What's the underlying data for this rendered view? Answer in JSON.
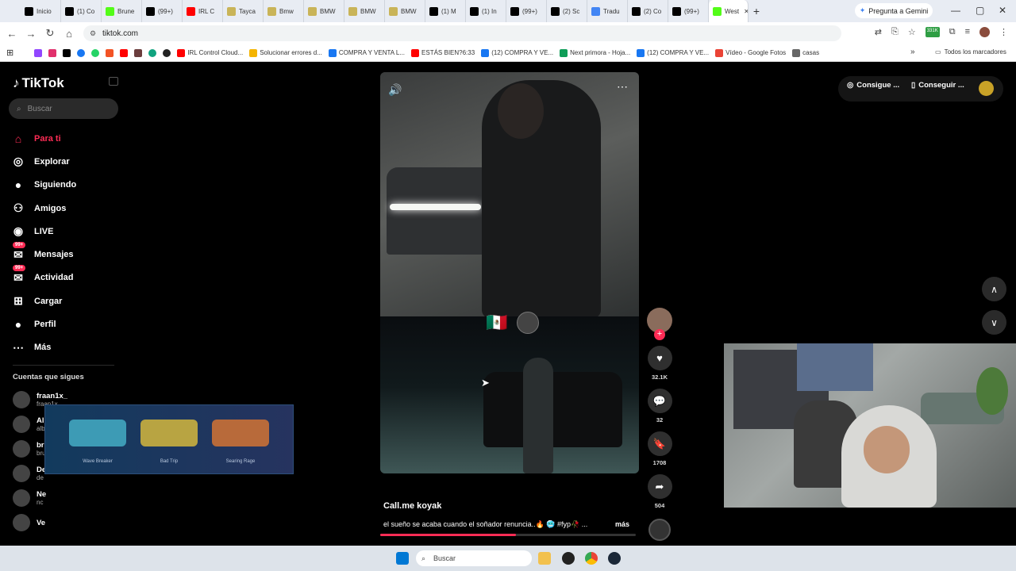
{
  "browser": {
    "tabs": [
      {
        "label": "Inicio",
        "icon": "x-icon",
        "color": "#000000"
      },
      {
        "label": "(1) Co",
        "icon": "x-icon",
        "color": "#000000"
      },
      {
        "label": "Brune",
        "icon": "kick-icon",
        "color": "#53fc18"
      },
      {
        "label": "(99+)",
        "icon": "tiktok-icon",
        "color": "#000000"
      },
      {
        "label": "IRL C",
        "icon": "youtube-icon",
        "color": "#ff0000"
      },
      {
        "label": "Tayca",
        "icon": "car-icon",
        "color": "#c9b458"
      },
      {
        "label": "Bmw",
        "icon": "car-icon",
        "color": "#c9b458"
      },
      {
        "label": "BMW",
        "icon": "car-icon",
        "color": "#c9b458"
      },
      {
        "label": "BMW",
        "icon": "car-icon",
        "color": "#c9b458"
      },
      {
        "label": "BMW",
        "icon": "car-icon",
        "color": "#c9b458"
      },
      {
        "label": "(1) M",
        "icon": "x-icon",
        "color": "#000000"
      },
      {
        "label": "(1) In",
        "icon": "x-icon",
        "color": "#000000"
      },
      {
        "label": "(99+)",
        "icon": "tiktok-icon",
        "color": "#000000"
      },
      {
        "label": "(2) Sc",
        "icon": "x-icon",
        "color": "#000000"
      },
      {
        "label": "Tradu",
        "icon": "translate-icon",
        "color": "#4285f4"
      },
      {
        "label": "(2) Co",
        "icon": "x-icon",
        "color": "#000000"
      },
      {
        "label": "(99+)",
        "icon": "tiktok-icon",
        "color": "#000000"
      },
      {
        "label": "West",
        "icon": "kick-icon",
        "color": "#53fc18"
      }
    ],
    "active_tab_close": "✕",
    "new_tab": "+",
    "gemini_label": "Pregunta a Gemini",
    "url": "tiktok.com",
    "extension_badge": "331K",
    "bookmarks": [
      {
        "label": "IRL Control Cloud...",
        "color": "#ff0000"
      },
      {
        "label": "Solucionar errores d...",
        "color": "#f4b400"
      },
      {
        "label": "COMPRA Y VENTA L...",
        "color": "#1877f2"
      },
      {
        "label": "ESTÁS BIEN?6:33",
        "color": "#ff0000"
      },
      {
        "label": "(12) COMPRA Y VE...",
        "color": "#1877f2"
      },
      {
        "label": "Next primora - Hoja...",
        "color": "#0f9d58"
      },
      {
        "label": "(12) COMPRA Y VE...",
        "color": "#1877f2"
      },
      {
        "label": "Vídeo - Google Fotos",
        "color": "#ea4335"
      },
      {
        "label": "casas",
        "color": "#666666"
      }
    ],
    "all_bookmarks": "Todos los marcadores"
  },
  "tiktok": {
    "logo": "TikTok",
    "search_placeholder": "Buscar",
    "nav": [
      {
        "label": "Para ti",
        "icon": "home-icon",
        "active": true
      },
      {
        "label": "Explorar",
        "icon": "compass-icon"
      },
      {
        "label": "Siguiendo",
        "icon": "following-icon"
      },
      {
        "label": "Amigos",
        "icon": "friends-icon"
      },
      {
        "label": "LIVE",
        "icon": "live-icon"
      },
      {
        "label": "Mensajes",
        "icon": "message-icon",
        "badge": "99+"
      },
      {
        "label": "Actividad",
        "icon": "activity-icon",
        "badge": "99+"
      },
      {
        "label": "Cargar",
        "icon": "upload-icon"
      },
      {
        "label": "Perfil",
        "icon": "profile-icon"
      },
      {
        "label": "Más",
        "icon": "more-icon"
      }
    ],
    "following_title": "Cuentas que sigues",
    "accounts": [
      {
        "name": "fraan1x_",
        "user": "fraan1x_"
      },
      {
        "name": "Albarro.oficial",
        "user": "albarro.oficial"
      },
      {
        "name": "brunenger.recortes",
        "user": "brunenger.recortes"
      },
      {
        "name": "De",
        "user": "de"
      },
      {
        "name": "Ne",
        "user": "nc"
      },
      {
        "name": "Ve",
        "user": ""
      }
    ],
    "video": {
      "author": "Call.me koyak",
      "description": "el sueño se acaba cuando el soñador renuncia..🔥 🥶 #fyp🥀 ...",
      "more": "más",
      "progress": 0.53,
      "flag": "🇲🇽"
    },
    "actions": {
      "likes": "32.1K",
      "comments": "32",
      "saves": "1708",
      "shares": "504"
    },
    "top_buttons": {
      "coins": "Consigue ...",
      "app": "Conseguir ..."
    }
  },
  "overlay": {
    "skins": [
      "Wave Breaker",
      "Bad Trip",
      "Searing Rage"
    ]
  },
  "taskbar": {
    "search_placeholder": "Buscar"
  }
}
